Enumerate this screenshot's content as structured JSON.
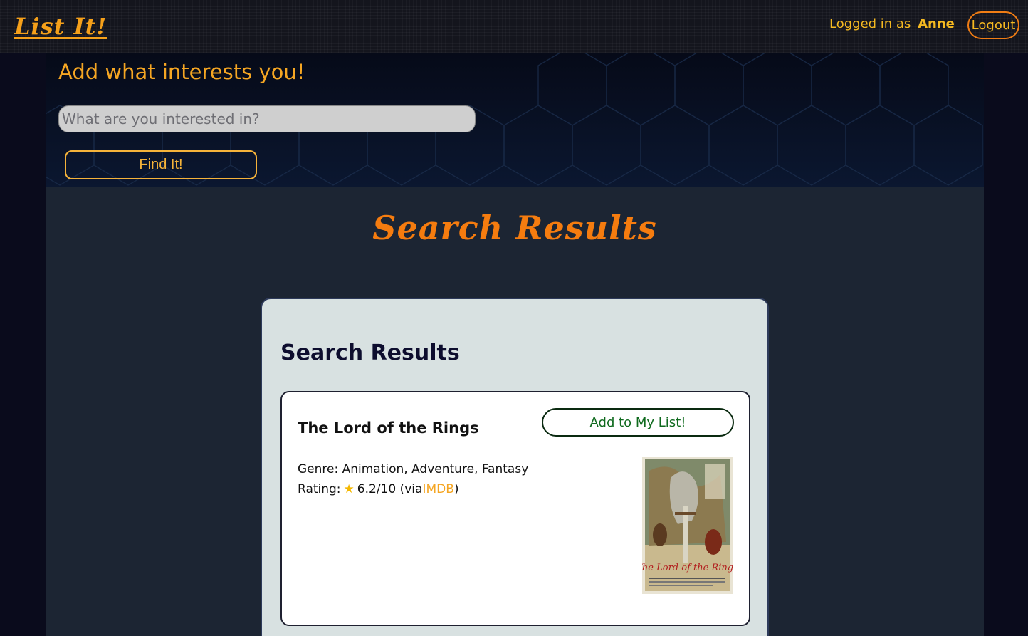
{
  "nav": {
    "logo": "List It!",
    "logged_in_prefix": "Logged in as",
    "username": "Anne",
    "logout_label": "Logout"
  },
  "hero": {
    "title": "Add what interests you!",
    "search_placeholder": "What are you interested in?",
    "search_value": "",
    "find_label": "Find It!"
  },
  "main": {
    "heading": "Search Results",
    "panel_title": "Search Results",
    "results": [
      {
        "title": "The Lord of the Rings",
        "add_label": "Add to My List!",
        "genre_label": "Genre:",
        "genre": "Animation, Adventure, Fantasy",
        "rating_label": "Rating:",
        "rating": "6.2/10",
        "rating_via_prefix": "(via",
        "rating_source": "IMDB",
        "rating_via_suffix": ")",
        "poster_icon": "movie-poster-image"
      }
    ]
  },
  "colors": {
    "accent_orange": "#f57c0f",
    "accent_gold": "#f5b921",
    "add_green": "#0f6a1e",
    "panel_bg": "#d8e1e1",
    "main_bg": "#1c2533"
  }
}
